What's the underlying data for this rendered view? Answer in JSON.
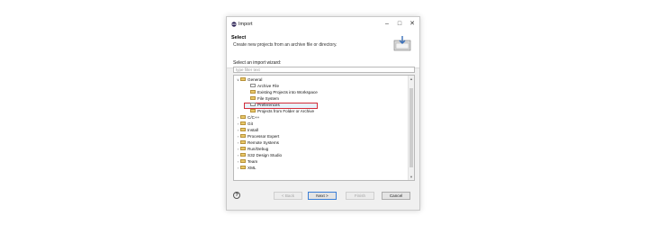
{
  "window": {
    "title": "Import",
    "controls": [
      "minimize",
      "maximize",
      "close"
    ]
  },
  "header": {
    "title": "Select",
    "description": "Create new projects from an archive file or directory."
  },
  "wizard": {
    "label": "Select an import wizard:",
    "filter_placeholder": "type filter text"
  },
  "tree": {
    "general": "General",
    "general_children": [
      "Archive File",
      "Existing Projects into Workspace",
      "File System",
      "Preferences",
      "Projects from Folder or Archive"
    ],
    "folders": [
      "C/C++",
      "Git",
      "Install",
      "Processor Expert",
      "Remote Systems",
      "Run/Debug",
      "S32 Design Studio",
      "Team",
      "XML"
    ],
    "selected": "Existing Projects into Workspace"
  },
  "buttons": {
    "help": "?",
    "back": "< Back",
    "next": "Next >",
    "finish": "Finish",
    "cancel": "Cancel"
  }
}
